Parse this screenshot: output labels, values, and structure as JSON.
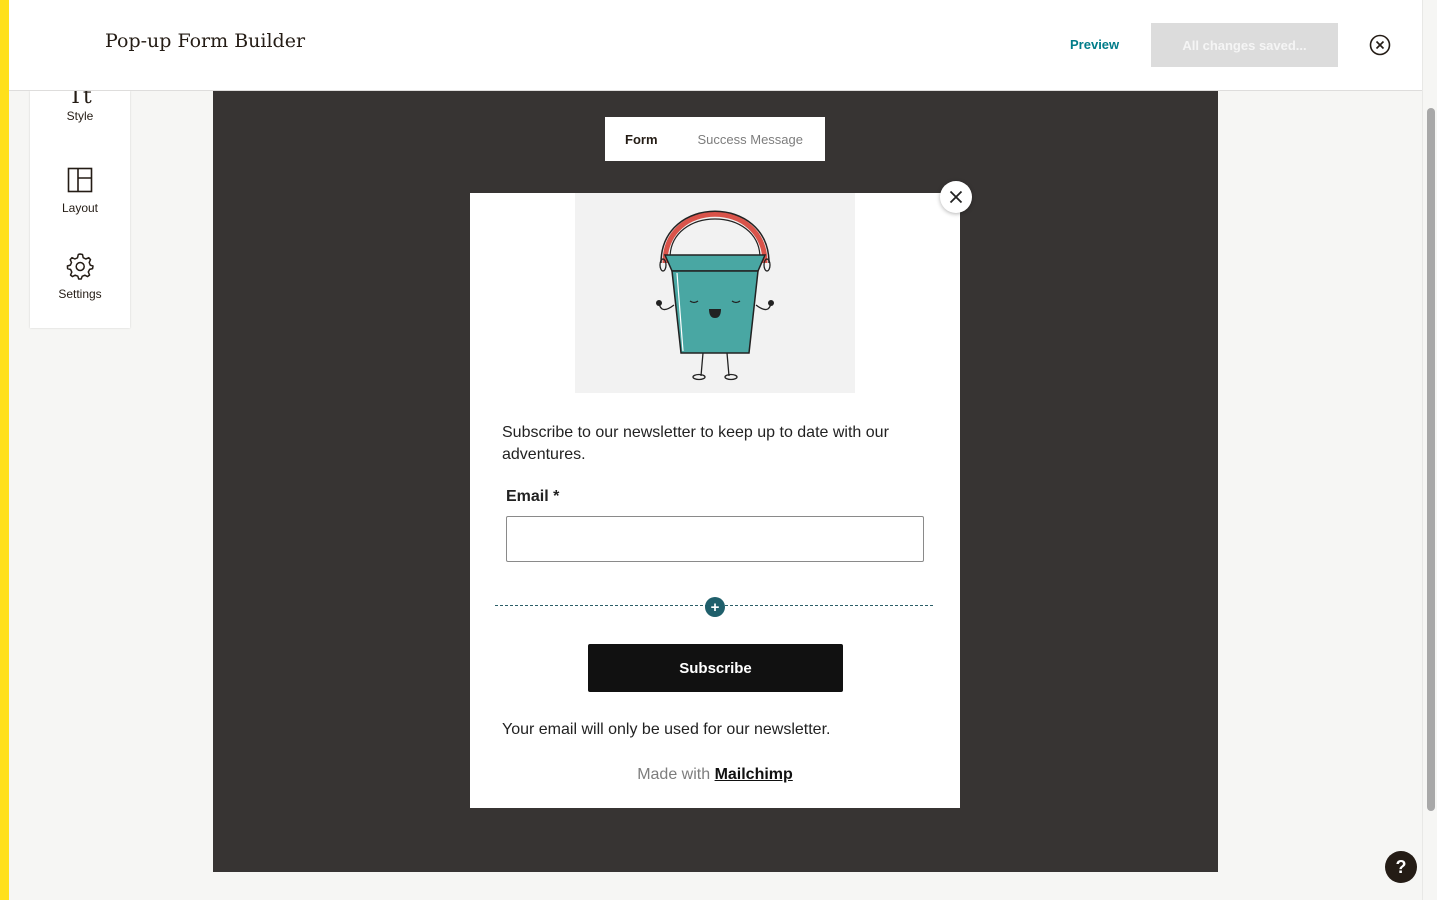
{
  "header": {
    "title": "Pop-up Form Builder",
    "preview_label": "Preview",
    "save_status": "All changes saved..."
  },
  "sidebar": {
    "items": [
      {
        "label": "Style",
        "icon": "typography-icon"
      },
      {
        "label": "Layout",
        "icon": "layout-icon"
      },
      {
        "label": "Settings",
        "icon": "gear-icon"
      }
    ]
  },
  "tabs": [
    {
      "label": "Form",
      "active": true
    },
    {
      "label": "Success Message",
      "active": false
    }
  ],
  "popup": {
    "intro_text": "Subscribe to our newsletter to keep up to date with our adventures.",
    "email_label": "Email *",
    "email_value": "",
    "add_symbol": "+",
    "subscribe_label": "Subscribe",
    "footnote": "Your email will only be used for our newsletter.",
    "made_with_prefix": "Made with",
    "made_with_link": "Mailchimp"
  },
  "help": {
    "label": "?"
  },
  "colors": {
    "accent": "#007c89",
    "brand_yellow": "#ffe01b",
    "canvas_bg": "#373433",
    "button_bg": "#111111",
    "add_button": "#1f5f6b"
  }
}
